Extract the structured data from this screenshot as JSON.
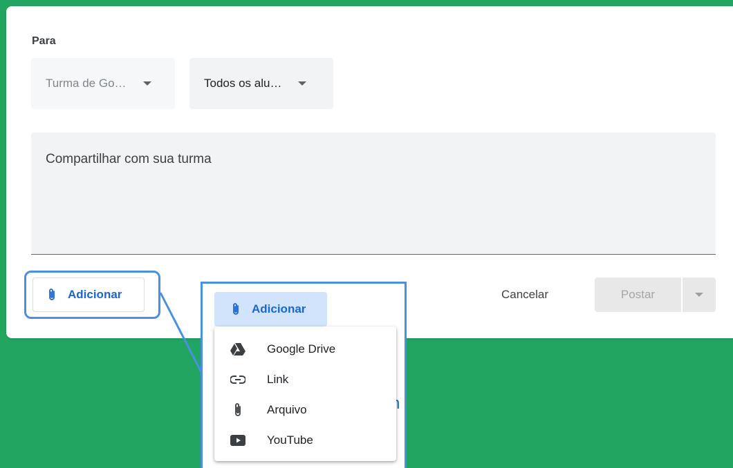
{
  "form": {
    "to_label": "Para",
    "class_select": "Turma de Go…",
    "students_select": "Todos os alu…",
    "share_placeholder": "Compartilhar com sua turma",
    "add_label": "Adicionar",
    "cancel_label": "Cancelar",
    "post_label": "Postar"
  },
  "zoom": {
    "add_label": "Adicionar",
    "behind_text": "n",
    "menu_items": [
      {
        "label": "Google Drive",
        "icon": "google-drive-icon"
      },
      {
        "label": "Link",
        "icon": "link-icon"
      },
      {
        "label": "Arquivo",
        "icon": "paperclip-icon"
      },
      {
        "label": "YouTube",
        "icon": "youtube-icon"
      }
    ]
  },
  "colors": {
    "background": "#22a560",
    "accent": "#1967d2",
    "highlight": "#4a90e2"
  }
}
